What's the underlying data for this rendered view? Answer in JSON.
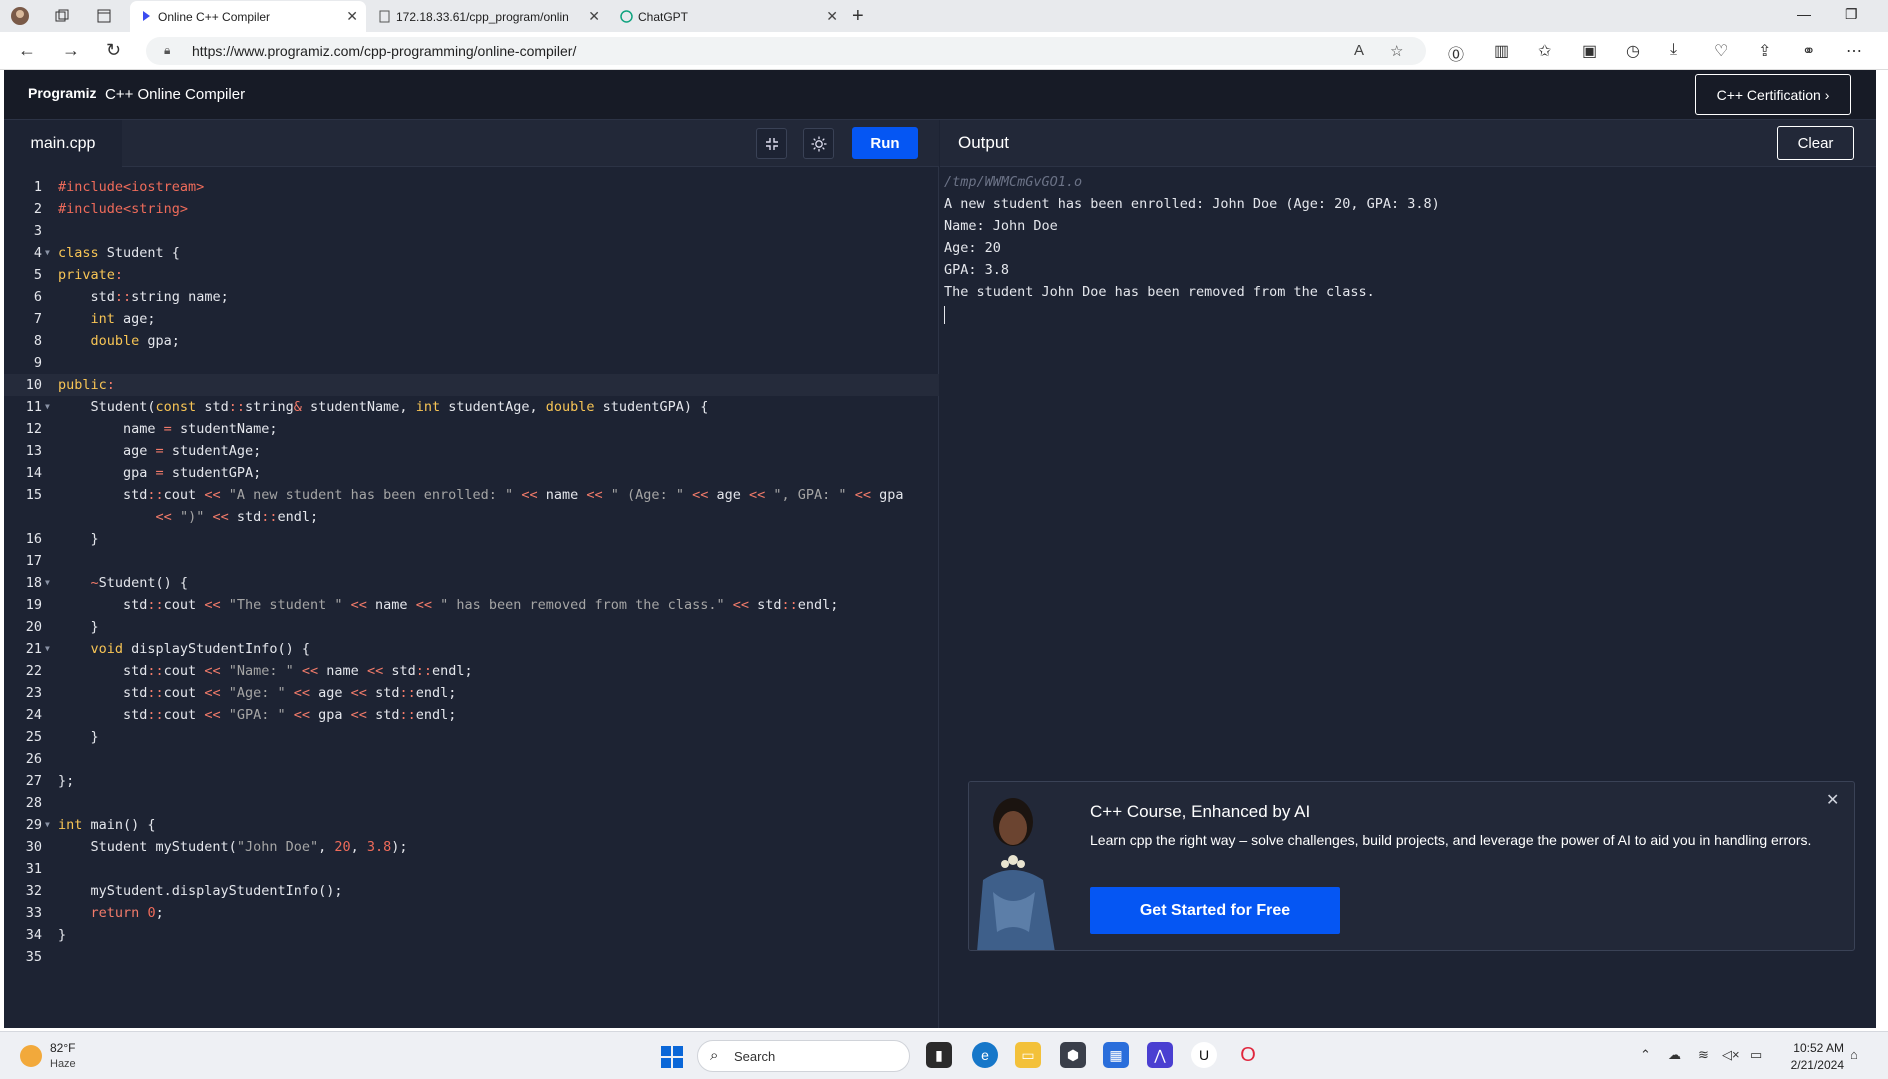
{
  "browser": {
    "tabs": [
      {
        "title": "Online C++ Compiler",
        "active": true
      },
      {
        "title": "172.18.33.61/cpp_program/onlin",
        "active": false
      },
      {
        "title": "ChatGPT",
        "active": false
      }
    ],
    "url": "https://www.programiz.com/cpp-programming/online-compiler/"
  },
  "header": {
    "logo": "Programiz",
    "title": "C++ Online Compiler",
    "cert_button": "C++ Certification ›"
  },
  "editor": {
    "file_tab": "main.cpp",
    "run_label": "Run"
  },
  "code_lines": [
    {
      "n": "1",
      "fold": false,
      "html": "<span class=\"inc\">#include&lt;iostream&gt;</span>"
    },
    {
      "n": "2",
      "fold": false,
      "html": "<span class=\"inc\">#include&lt;string&gt;</span>"
    },
    {
      "n": "3",
      "fold": false,
      "html": ""
    },
    {
      "n": "4",
      "fold": true,
      "html": "<span class=\"kw\">class</span> Student {"
    },
    {
      "n": "5",
      "fold": false,
      "html": "<span class=\"kw\">private</span><span class=\"op\">:</span>"
    },
    {
      "n": "6",
      "fold": false,
      "html": "    std<span class=\"op\">::</span>string name;"
    },
    {
      "n": "7",
      "fold": false,
      "html": "    <span class=\"kw\">int</span> age;"
    },
    {
      "n": "8",
      "fold": false,
      "html": "    <span class=\"kw\">double</span> gpa;"
    },
    {
      "n": "9",
      "fold": false,
      "html": ""
    },
    {
      "n": "10",
      "fold": false,
      "cur": true,
      "html": "<span class=\"kw\">public</span><span class=\"op\">:</span>"
    },
    {
      "n": "11",
      "fold": true,
      "html": "    Student(<span class=\"kw\">const</span> std<span class=\"op\">::</span>string<span class=\"op\">&amp;</span> studentName, <span class=\"kw\">int</span> studentAge, <span class=\"kw\">double</span> studentGPA) {"
    },
    {
      "n": "12",
      "fold": false,
      "html": "        name <span class=\"op\">=</span> studentName;"
    },
    {
      "n": "13",
      "fold": false,
      "html": "        age <span class=\"op\">=</span> studentAge;"
    },
    {
      "n": "14",
      "fold": false,
      "html": "        gpa <span class=\"op\">=</span> studentGPA;"
    },
    {
      "n": "15",
      "fold": false,
      "html": "        std<span class=\"op\">::</span>cout <span class=\"op\">&lt;&lt;</span> <span class=\"str\">\"A new student has been enrolled: \"</span> <span class=\"op\">&lt;&lt;</span> name <span class=\"op\">&lt;&lt;</span> <span class=\"str\">\" (Age: \"</span> <span class=\"op\">&lt;&lt;</span> age <span class=\"op\">&lt;&lt;</span> <span class=\"str\">\", GPA: \"</span> <span class=\"op\">&lt;&lt;</span> gpa"
    },
    {
      "n": "",
      "fold": false,
      "html": "            <span class=\"op\">&lt;&lt;</span> <span class=\"str\">\")\"</span> <span class=\"op\">&lt;&lt;</span> std<span class=\"op\">::</span>endl;"
    },
    {
      "n": "16",
      "fold": false,
      "html": "    }"
    },
    {
      "n": "17",
      "fold": false,
      "html": ""
    },
    {
      "n": "18",
      "fold": true,
      "html": "    <span class=\"op\">~</span>Student() {"
    },
    {
      "n": "19",
      "fold": false,
      "html": "        std<span class=\"op\">::</span>cout <span class=\"op\">&lt;&lt;</span> <span class=\"str\">\"The student \"</span> <span class=\"op\">&lt;&lt;</span> name <span class=\"op\">&lt;&lt;</span> <span class=\"str\">\" has been removed from the class.\"</span> <span class=\"op\">&lt;&lt;</span> std<span class=\"op\">::</span>endl;"
    },
    {
      "n": "20",
      "fold": false,
      "html": "    }"
    },
    {
      "n": "21",
      "fold": true,
      "html": "    <span class=\"kw\">void</span> displayStudentInfo() {"
    },
    {
      "n": "22",
      "fold": false,
      "html": "        std<span class=\"op\">::</span>cout <span class=\"op\">&lt;&lt;</span> <span class=\"str\">\"Name: \"</span> <span class=\"op\">&lt;&lt;</span> name <span class=\"op\">&lt;&lt;</span> std<span class=\"op\">::</span>endl;"
    },
    {
      "n": "23",
      "fold": false,
      "html": "        std<span class=\"op\">::</span>cout <span class=\"op\">&lt;&lt;</span> <span class=\"str\">\"Age: \"</span> <span class=\"op\">&lt;&lt;</span> age <span class=\"op\">&lt;&lt;</span> std<span class=\"op\">::</span>endl;"
    },
    {
      "n": "24",
      "fold": false,
      "html": "        std<span class=\"op\">::</span>cout <span class=\"op\">&lt;&lt;</span> <span class=\"str\">\"GPA: \"</span> <span class=\"op\">&lt;&lt;</span> gpa <span class=\"op\">&lt;&lt;</span> std<span class=\"op\">::</span>endl;"
    },
    {
      "n": "25",
      "fold": false,
      "html": "    }"
    },
    {
      "n": "26",
      "fold": false,
      "html": ""
    },
    {
      "n": "27",
      "fold": false,
      "html": "};"
    },
    {
      "n": "28",
      "fold": false,
      "html": ""
    },
    {
      "n": "29",
      "fold": true,
      "html": "<span class=\"kw\">int</span> main() {"
    },
    {
      "n": "30",
      "fold": false,
      "html": "    Student myStudent(<span class=\"str\">\"John Doe\"</span>, <span class=\"num\">20</span>, <span class=\"num\">3.8</span>);"
    },
    {
      "n": "31",
      "fold": false,
      "html": ""
    },
    {
      "n": "32",
      "fold": false,
      "html": "    myStudent.displayStudentInfo();"
    },
    {
      "n": "33",
      "fold": false,
      "html": "    <span class=\"op\">return</span> <span class=\"num\">0</span>;"
    },
    {
      "n": "34",
      "fold": false,
      "html": "}"
    },
    {
      "n": "35",
      "fold": false,
      "html": ""
    }
  ],
  "output": {
    "label": "Output",
    "clear_label": "Clear",
    "path": "/tmp/WWMCmGvGO1.o",
    "lines": [
      "A new student has been enrolled: John Doe (Age: 20, GPA: 3.8)",
      "Name: John Doe",
      "Age: 20",
      "GPA: 3.8",
      "The student John Doe has been removed from the class."
    ]
  },
  "promo": {
    "title": "C++ Course, Enhanced by AI",
    "desc": "Learn cpp the right way – solve challenges, build projects, and leverage the power of AI to aid you in handling errors.",
    "cta": "Get Started for Free"
  },
  "taskbar": {
    "temp": "82°F",
    "condition": "Haze",
    "search": "Search",
    "time": "10:52 AM",
    "date": "2/21/2024"
  },
  "colors": {
    "accent": "#0556f3",
    "editor_bg": "#1d2333",
    "keyword": "#f8c555",
    "string": "#a5a5a5",
    "number": "#ef6b5a"
  }
}
